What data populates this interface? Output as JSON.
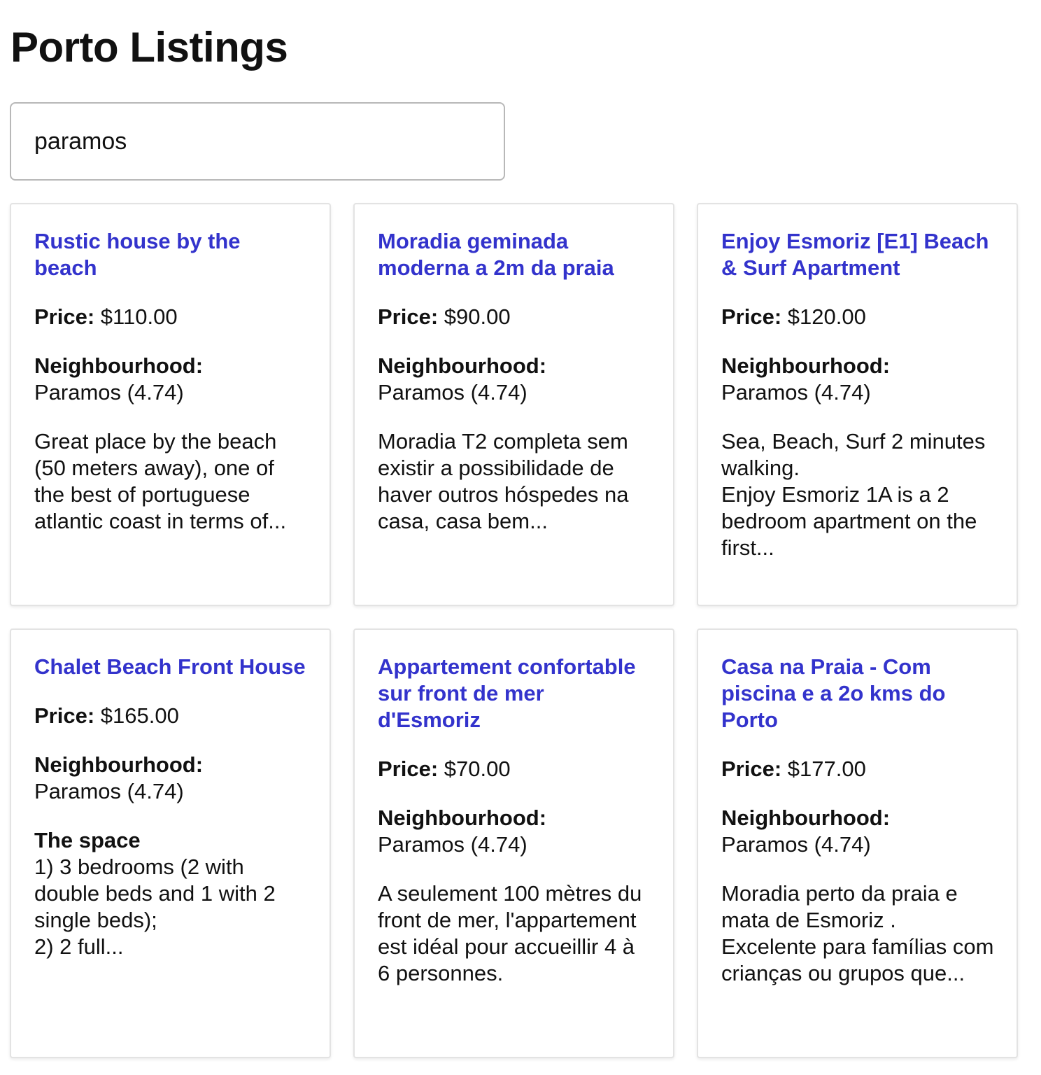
{
  "header": {
    "title": "Porto Listings"
  },
  "search": {
    "value": "paramos",
    "placeholder": ""
  },
  "labels": {
    "price": "Price:",
    "neighbourhood": "Neighbourhood:"
  },
  "listings": [
    {
      "title": "Rustic house by the beach",
      "price": "$110.00",
      "neighbourhood": "Paramos (4.74)",
      "summary_heading": "",
      "summary": "Great place by the beach (50 meters away), one of the best of portuguese atlantic coast in terms of..."
    },
    {
      "title": "Moradia geminada moderna a 2m da praia",
      "price": "$90.00",
      "neighbourhood": "Paramos (4.74)",
      "summary_heading": "",
      "summary": "Moradia T2 completa sem existir a possibilidade de haver outros hóspedes na casa, casa bem..."
    },
    {
      "title": "Enjoy Esmoriz [E1] Beach & Surf Apartment",
      "price": "$120.00",
      "neighbourhood": "Paramos (4.74)",
      "summary_heading": "",
      "summary": "Sea, Beach, Surf 2 minutes walking.\nEnjoy Esmoriz 1A is a 2 bedroom apartment on the first..."
    },
    {
      "title": "Chalet Beach Front House",
      "price": "$165.00",
      "neighbourhood": "Paramos (4.74)",
      "summary_heading": "The space",
      "summary": "1) 3 bedrooms (2 with double beds and 1 with 2 single beds);\n2) 2 full..."
    },
    {
      "title": "Appartement confortable sur front de mer d'Esmoriz",
      "price": "$70.00",
      "neighbourhood": "Paramos (4.74)",
      "summary_heading": "",
      "summary": "A seulement 100 mètres du front de mer, l'appartement est idéal pour accueillir 4 à 6 personnes."
    },
    {
      "title": "Casa na Praia - Com piscina e a 2o kms do Porto",
      "price": "$177.00",
      "neighbourhood": "Paramos (4.74)",
      "summary_heading": "",
      "summary": "Moradia perto da praia e mata de Esmoriz .\nExcelente para famílias com crianças ou grupos que..."
    }
  ]
}
